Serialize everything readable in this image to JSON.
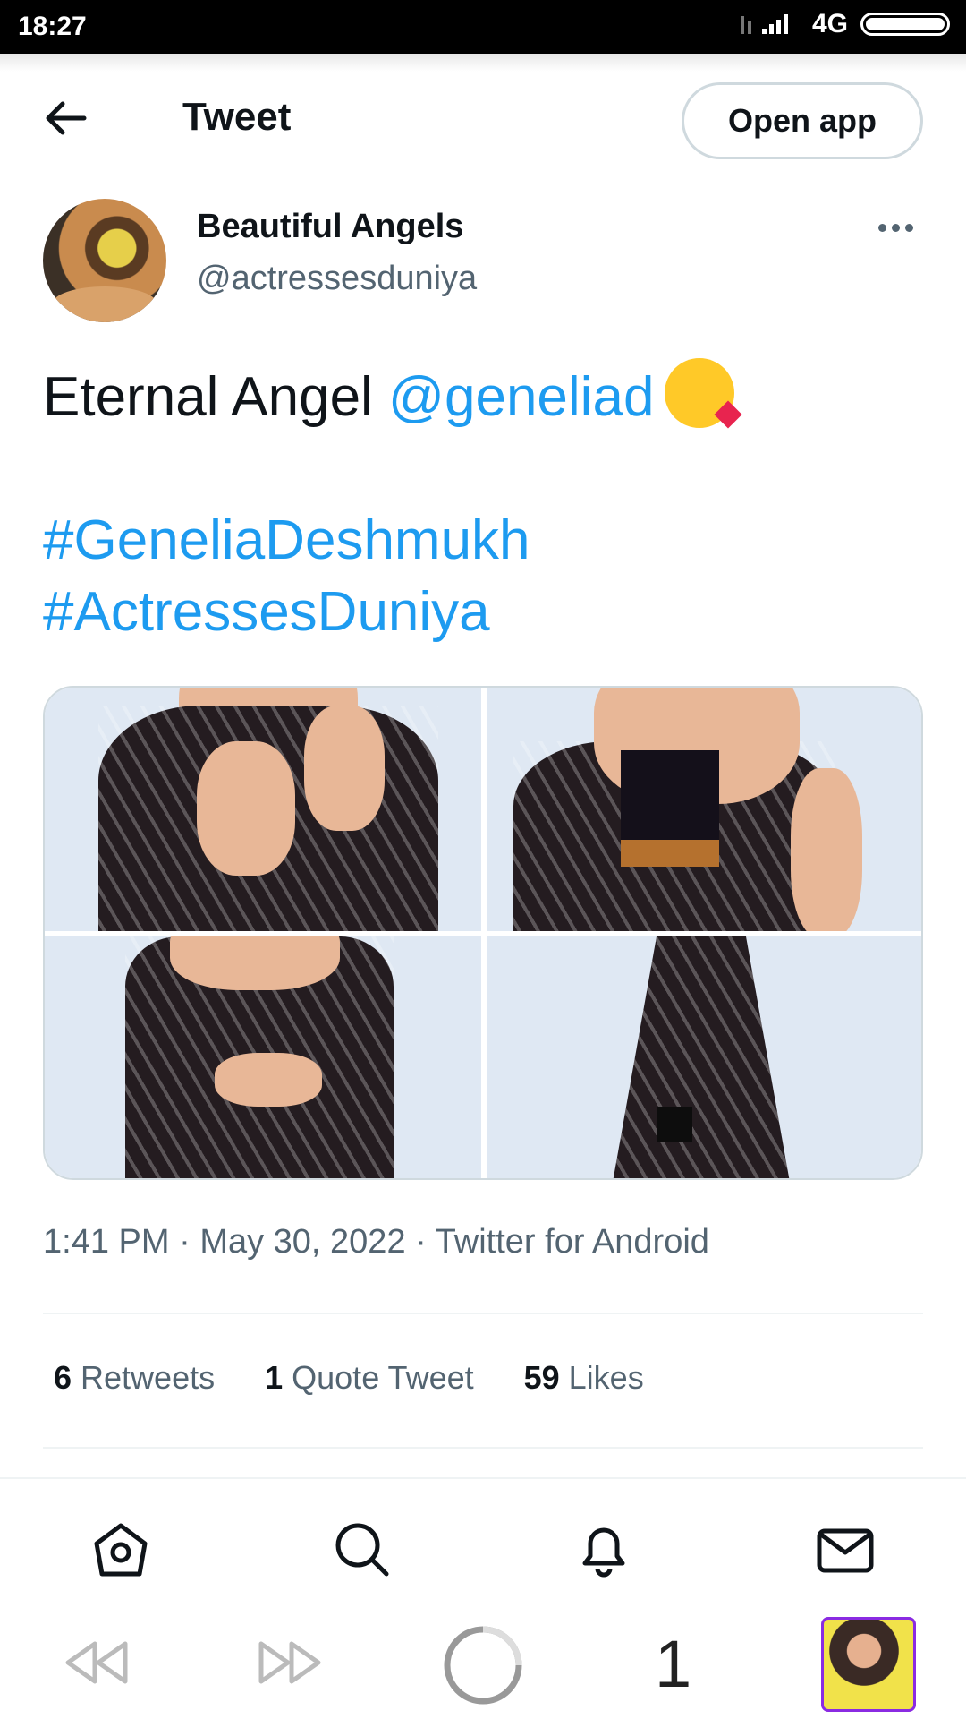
{
  "status_bar": {
    "time": "18:27",
    "network": "4G"
  },
  "header": {
    "title": "Tweet",
    "open_app_label": "Open app"
  },
  "tweet": {
    "display_name": "Beautiful Angels",
    "handle": "@actressesduniya",
    "text_prefix": "Eternal Angel ",
    "mention": "@geneliad",
    "hashtag_1": "#GeneliaDeshmukh",
    "hashtag_2": "#ActressesDuniya",
    "time": "1:41 PM",
    "date": "May 30, 2022",
    "source": "Twitter for Android",
    "separator": "·"
  },
  "stats": {
    "retweets_count": "6",
    "retweets_label": "Retweets",
    "quotes_count": "1",
    "quotes_label": "Quote Tweet",
    "likes_count": "59",
    "likes_label": "Likes"
  },
  "bottom_nav": [
    "home-icon",
    "search-icon",
    "notifications-icon",
    "messages-icon"
  ],
  "browser_bar": {
    "tab_count": "1"
  },
  "colors": {
    "link": "#1d9bf0",
    "muted": "#536471",
    "text": "#0f1419",
    "border": "#cfd9de"
  }
}
